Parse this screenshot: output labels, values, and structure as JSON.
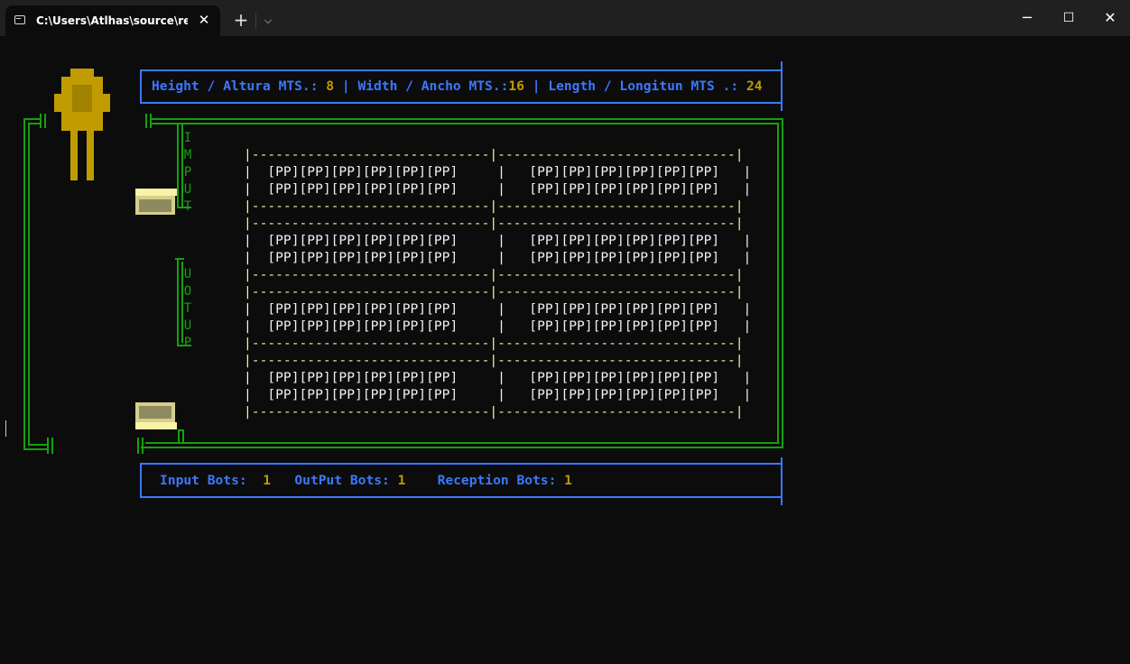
{
  "window": {
    "tab_title": "C:\\Users\\Atlhas\\source\\repos\\",
    "tab_close": "✕",
    "new_tab": "+",
    "dropdown": "⌵",
    "minimize": "─",
    "maximize": "☐",
    "close": "✕"
  },
  "header": {
    "height_label": "Height / Altura MTS.: ",
    "height_value": "8",
    "sep1": " | ",
    "width_label": "Width / Ancho MTS.:",
    "width_value": "16",
    "sep2": " | ",
    "length_label": "Length / Longitun MTS .: ",
    "length_value": "24"
  },
  "side_labels": {
    "input": [
      "I",
      "M",
      "P",
      "U",
      "T"
    ],
    "output": [
      "U",
      "O",
      "T",
      "U",
      "P"
    ]
  },
  "grid": {
    "separator": "|------------------------------|------------------------------|",
    "row": "|  [PP][PP][PP][PP][PP][PP]     |   [PP][PP][PP][PP][PP][PP]   |",
    "sections": 4
  },
  "footer": {
    "input_label": "Input Bots:",
    "input_value": "1",
    "output_label": "OutPut Bots:",
    "output_value": "1",
    "reception_label": "Reception Bots:",
    "reception_value": "1"
  },
  "colors": {
    "blue": "#3b78ff",
    "gold": "#c19c00",
    "green": "#13a10e",
    "light_yellow": "#f9f1a5",
    "background": "#0c0c0c"
  }
}
